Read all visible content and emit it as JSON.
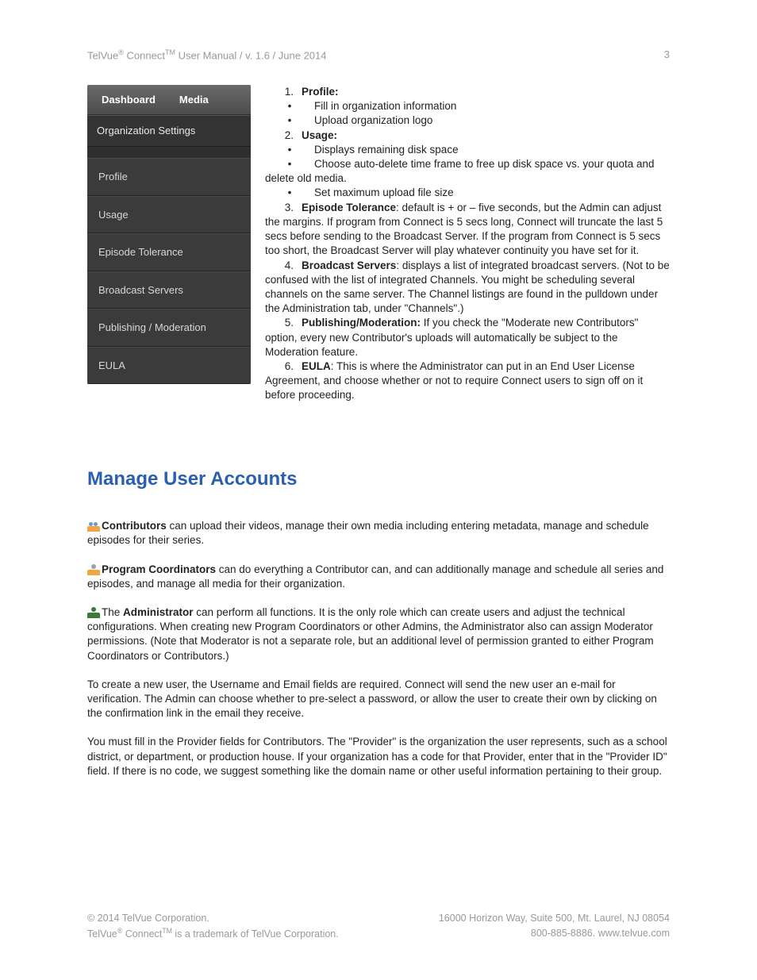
{
  "header": {
    "title_pre": "TelVue",
    "reg": "®",
    "title_mid": " Connect",
    "tm": "TM",
    "title_post": " User Manual  / v. 1.6 / June 2014",
    "pagenum": "3"
  },
  "sidebar": {
    "tabs": [
      "Dashboard",
      "Media"
    ],
    "section": "Organization Settings",
    "items": [
      "Profile",
      "Usage",
      "Episode Tolerance",
      "Broadcast Servers",
      "Publishing / Moderation",
      "EULA"
    ]
  },
  "list": {
    "i1": {
      "num": "1.",
      "label": "Profile:",
      "b1": "Fill in organization information",
      "b2": "Upload organization logo"
    },
    "i2": {
      "num": "2.",
      "label": "Usage:",
      "b1": "Displays remaining disk space",
      "b2": "Choose auto-delete time frame to free up disk space vs. your quota and delete old media.",
      "b3": "Set maximum upload file size"
    },
    "i3": {
      "num": "3.",
      "label": "Episode Tolerance",
      "rest": ":  default is + or – five seconds, but the Admin can adjust the margins.  If program from Connect is 5 secs long, Connect will truncate the last 5 secs before sending to the Broadcast Server.  If the program from Connect is 5 secs too short, the Broadcast Server will play whatever continuity you have set for it."
    },
    "i4": {
      "num": "4.",
      "label": "Broadcast Servers",
      "rest": ":  displays a list of integrated broadcast servers. (Not to be confused with the list of integrated Channels.  You might be scheduling several channels on the same server. The Channel listings are found in the pulldown under the Administration tab, under \"Channels\".)"
    },
    "i5": {
      "num": "5.",
      "label": "Publishing/Moderation:",
      "rest": "  If you check the \"Moderate new Contributors\" option, every new Contributor's uploads will automatically be subject to the Moderation feature."
    },
    "i6": {
      "num": "6.",
      "label": "EULA",
      "rest": ":  This is where the Administrator can put in an End User License Agreement, and choose whether or not to require Connect users to sign off on it before proceeding."
    }
  },
  "section_title": "Manage User Accounts",
  "roles": {
    "contrib_label": "Contributors",
    "contrib_text": " can upload their videos, manage their own media including entering metadata, manage and schedule episodes for their series.",
    "pc_label": "Program Coordinators",
    "pc_text": " can do everything a Contributor can, and can additionally manage and schedule all series and episodes, and manage all media for their organization.",
    "admin_pre": "The ",
    "admin_label": "Administrator",
    "admin_text": " can perform all functions.  It is the only role which can create users and adjust the technical configurations. When creating new Program Coordinators or other Admins, the Administrator also can assign Moderator permissions. (Note that Moderator is not a separate role, but an additional level of permission granted to either Program Coordinators or Contributors.)"
  },
  "body": {
    "p1": "To create a new user, the Username and Email fields are required.  Connect will send the new user an e-mail for verification.  The Admin can choose whether to pre-select a password, or allow the user to create their own by clicking on the confirmation link in the email they receive.",
    "p2": "You must fill in the Provider fields for Contributors.  The \"Provider\" is the organization the user represents, such as a school district, or department, or production house.  If your organization has a code for that Provider, enter that in the \"Provider ID\" field.   If there is no code, we suggest something like the domain name or other useful information pertaining to their group."
  },
  "footer": {
    "l1": "© 2014 TelVue Corporation.",
    "l2_pre": "TelVue",
    "l2_reg": "®",
    "l2_mid": " Connect",
    "l2_tm": "TM",
    "l2_post": " is a trademark of TelVue Corporation.",
    "r1": "16000 Horizon Way, Suite 500, Mt. Laurel, NJ 08054",
    "r2_phone": "800-885-8886.  ",
    "r2_link": "www.telvue.com"
  }
}
